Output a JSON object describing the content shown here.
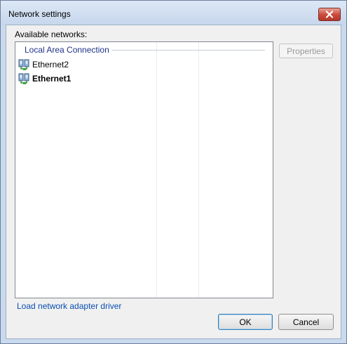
{
  "window": {
    "title": "Network settings"
  },
  "networks": {
    "label": "Available networks:",
    "group_title": "Local Area Connection",
    "items": [
      {
        "label": "Ethernet2",
        "bold": false,
        "icon": "network-adapter-icon"
      },
      {
        "label": "Ethernet1",
        "bold": true,
        "icon": "network-adapter-icon"
      }
    ]
  },
  "buttons": {
    "properties": "Properties",
    "ok": "OK",
    "cancel": "Cancel"
  },
  "links": {
    "load_driver": "Load network adapter driver"
  },
  "colors": {
    "link": "#0a4fb3",
    "group_title": "#1e3287",
    "close_button": "#c9483a"
  }
}
